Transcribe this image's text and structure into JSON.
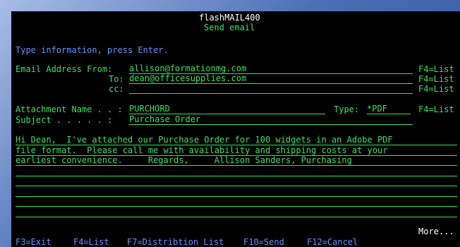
{
  "header": {
    "app_title": "flashMAIL400",
    "screen_title": "Send email"
  },
  "instruction": "Type information, press Enter.",
  "email": {
    "from_label": "Email Address From:",
    "from_value": "allison@formationmg.com",
    "to_label": "To:",
    "to_value": "dean@officesupplies.com",
    "cc_label": "cc:",
    "cc_value": "",
    "f4_list": "F4=List"
  },
  "attachment": {
    "name_label": "Attachment Name . . :",
    "name_value": "PURCHORD",
    "type_label": "Type:",
    "type_value": "*PDF",
    "f4_list": "F4=List"
  },
  "subject": {
    "label": "Subject . . . . . :",
    "value": "Purchase Order"
  },
  "body": {
    "lines": [
      "Hi Dean,  I've attached our Purchase Order for 100 widgets in an Adobe PDF",
      "file format.  Please call me with availability and shipping costs at your",
      "earliest convenience.     Regards,     Allison Sanders, Purchasing",
      "",
      "",
      "",
      "",
      ""
    ]
  },
  "more": "More...",
  "function_keys": {
    "f3": "F3=Exit",
    "f4": "F4=List",
    "f7": "F7=Distribtion List",
    "f10": "F10=Send",
    "f12": "F12=Cancel"
  },
  "colors": {
    "background": "#000000",
    "green": "#33e05f",
    "blue": "#5f92ff",
    "white": "#ffffff",
    "frame": "#4c6fb6"
  }
}
